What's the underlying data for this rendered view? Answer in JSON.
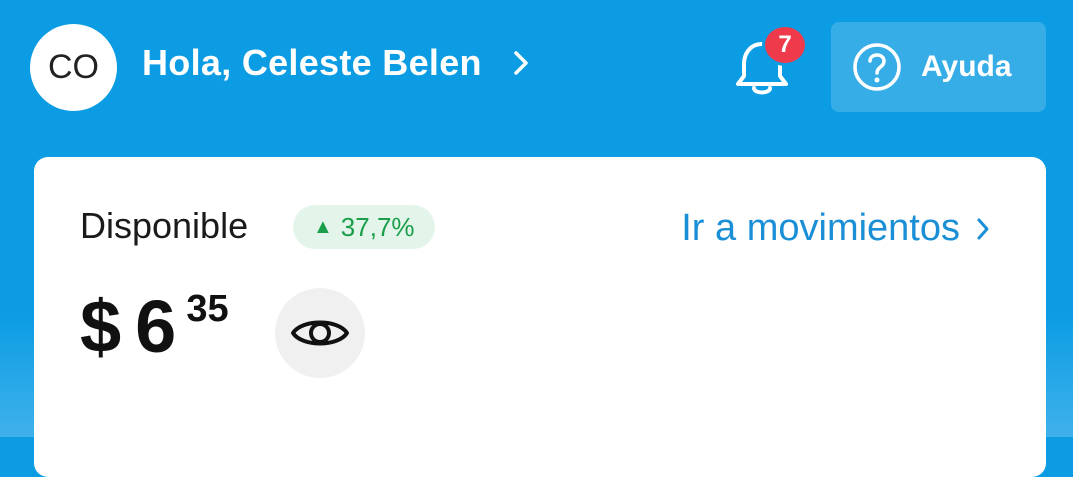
{
  "header": {
    "avatar_initials": "CO",
    "greeting": "Hola, Celeste Belen",
    "notifications_count": "7",
    "help_label": "Ayuda",
    "icons": [
      "chevron-right-icon",
      "bell-icon",
      "help-circle-icon"
    ]
  },
  "balance": {
    "label": "Disponible",
    "trend_arrow": "▲",
    "trend_value": "37,7%",
    "link_label": "Ir a movimientos",
    "currency": "$",
    "integer": "6",
    "cents": "35",
    "icons": [
      "eye-icon",
      "chevron-right-icon"
    ]
  },
  "colors": {
    "primary_blue": "#0b9ce3",
    "link_blue": "#1a8fd6",
    "trend_green": "#1a9e4a",
    "badge_red": "#ee3a4a"
  }
}
